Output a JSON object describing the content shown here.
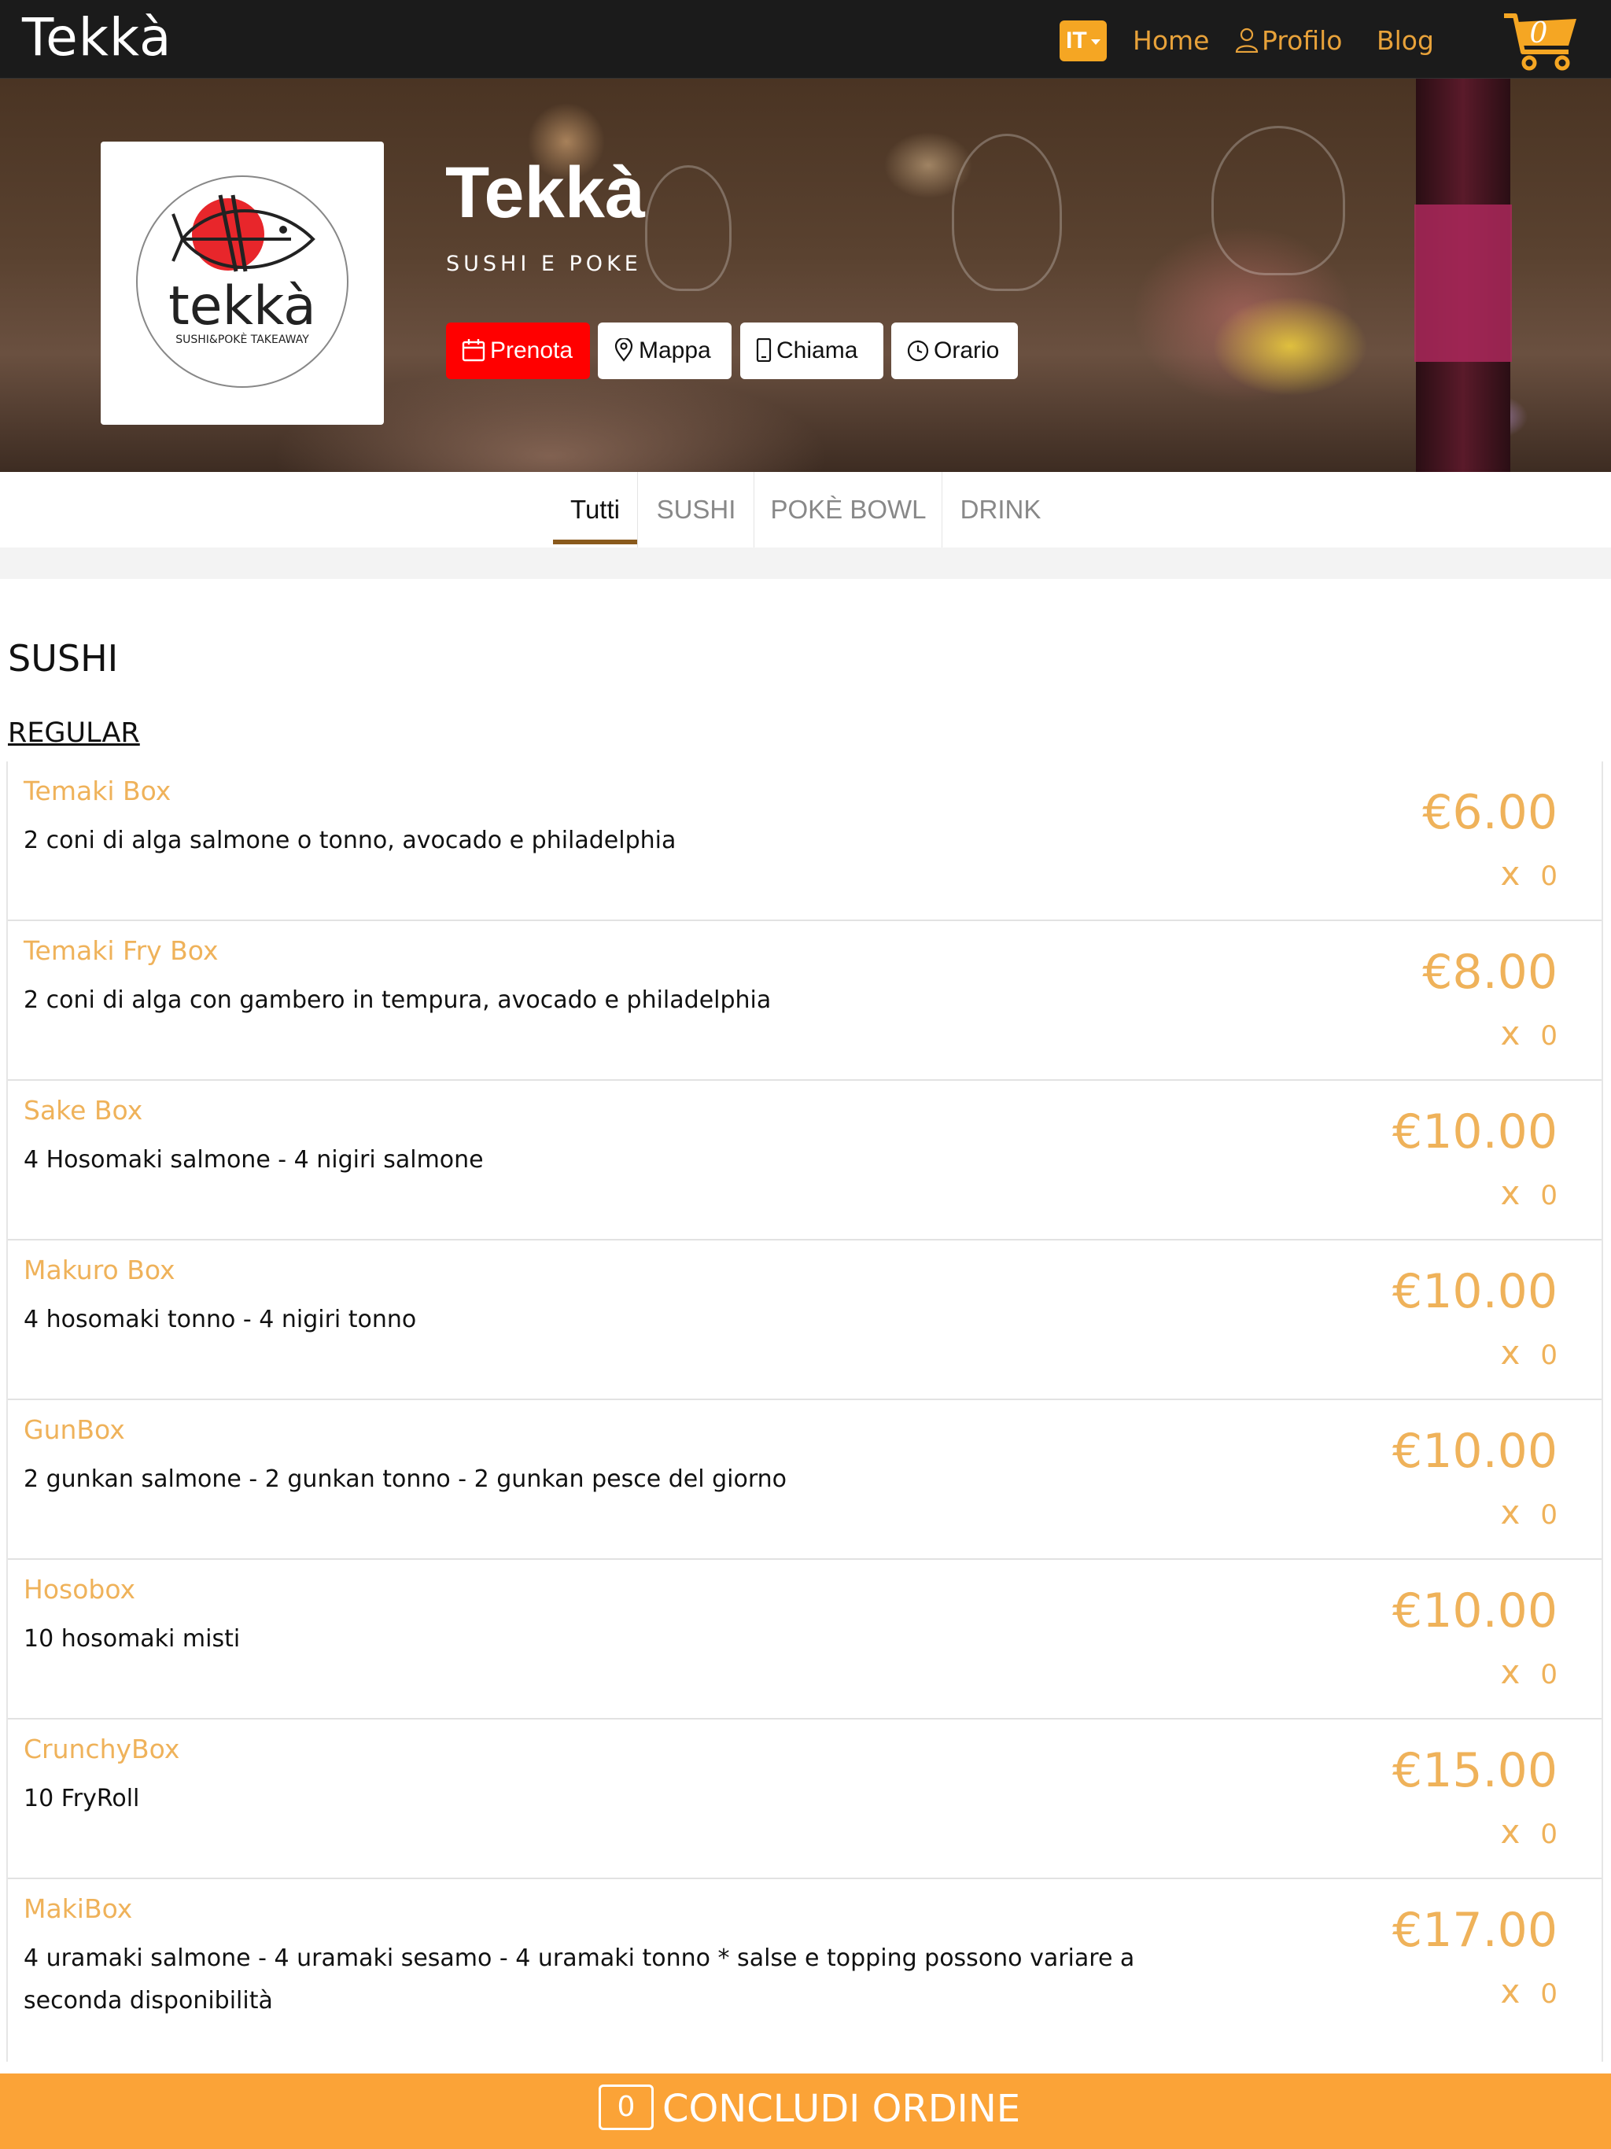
{
  "navbar": {
    "brand": "Tekkà",
    "language": "IT",
    "home_label": "Home",
    "profile_label": "Profilo",
    "blog_label": "Blog",
    "cart_count": "0",
    "accent_color": "#e8a23a"
  },
  "hero": {
    "title": "Tekkà",
    "subtitle": "SUSHI E POKE",
    "logo_text": "tekkà",
    "logo_tagline": "SUSHI&POKÈ TAKEAWAY",
    "buttons": {
      "prenota": "Prenota",
      "mappa": "Mappa",
      "chiama": "Chiama",
      "orario": "Orario"
    },
    "prenota_color": "#ff0000"
  },
  "tabs": [
    {
      "label": "Tutti",
      "active": true
    },
    {
      "label": "SUSHI",
      "active": false
    },
    {
      "label": "POKÈ BOWL",
      "active": false
    },
    {
      "label": "DRINK",
      "active": false
    }
  ],
  "menu": {
    "section_title": "SUSHI",
    "subsection_title": "REGULAR",
    "items": [
      {
        "name": "Temaki Box",
        "description": "2 coni di alga salmone o tonno, avocado e philadelphia",
        "price": "€6.00",
        "qty_prefix": "x",
        "qty": "0"
      },
      {
        "name": "Temaki Fry Box",
        "description": "2 coni di alga con gambero in tempura, avocado e philadelphia",
        "price": "€8.00",
        "qty_prefix": "x",
        "qty": "0"
      },
      {
        "name": "Sake Box",
        "description": "4 Hosomaki salmone - 4 nigiri salmone",
        "price": "€10.00",
        "qty_prefix": "x",
        "qty": "0"
      },
      {
        "name": "Makuro Box",
        "description": "4 hosomaki tonno - 4 nigiri tonno",
        "price": "€10.00",
        "qty_prefix": "x",
        "qty": "0"
      },
      {
        "name": "GunBox",
        "description": "2 gunkan salmone - 2 gunkan tonno - 2 gunkan pesce del giorno",
        "price": "€10.00",
        "qty_prefix": "x",
        "qty": "0"
      },
      {
        "name": "Hosobox",
        "description": "10 hosomaki misti",
        "price": "€10.00",
        "qty_prefix": "x",
        "qty": "0"
      },
      {
        "name": "CrunchyBox",
        "description": "10 FryRoll",
        "price": "€15.00",
        "qty_prefix": "x",
        "qty": "0"
      },
      {
        "name": "MakiBox",
        "description": "4 uramaki salmone - 4 uramaki sesamo - 4 uramaki tonno * salse e topping possono variare a seconda disponibilità",
        "price": "€17.00",
        "qty_prefix": "x",
        "qty": "0"
      }
    ]
  },
  "order_bar": {
    "count": "0",
    "label": "CONCLUDI ORDINE",
    "color": "#fba337"
  }
}
